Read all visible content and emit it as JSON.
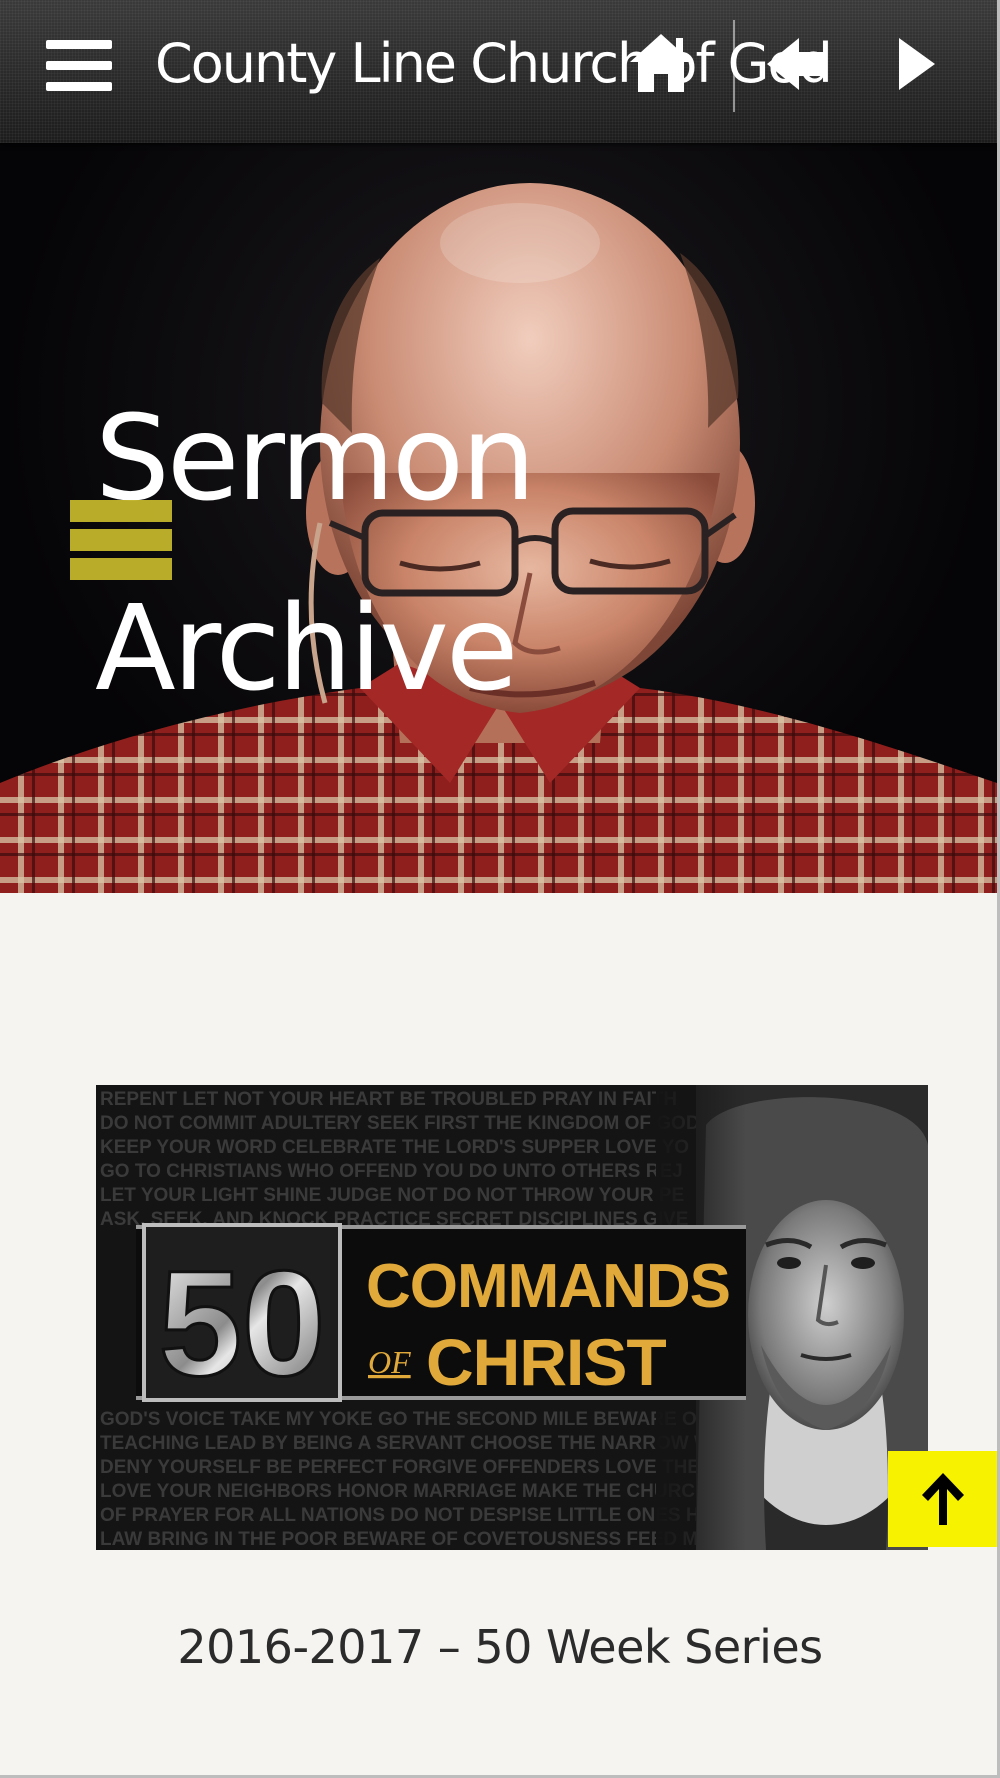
{
  "header": {
    "site_title": "County Line Church of God",
    "icons": [
      "menu-icon",
      "home-icon",
      "back-icon",
      "play-icon"
    ]
  },
  "hero": {
    "title_line1": "Sermon",
    "title_line2": "Archive"
  },
  "series": {
    "banner_number": "50",
    "banner_line1": "COMMANDS",
    "banner_of": "OF",
    "banner_line2": "CHRIST",
    "banner_background_text": [
      "REPENT  LET NOT YOUR HEART BE TROUBLED  PRAY IN FAITH",
      "DO NOT COMMIT ADULTERY  SEEK FIRST THE KINGDOM OF GOD",
      "KEEP YOUR WORD  CELEBRATE THE LORD'S SUPPER  LOVE YO",
      "GO TO CHRISTIANS WHO OFFEND YOU  DO UNTO OTHERS  REJ",
      "LET YOUR LIGHT SHINE  JUDGE NOT  DO NOT THROW YOUR PE",
      "ASK, SEEK, AND KNOCK  PRACTICE SECRET DISCIPLINES GIVE",
      "GOD'S VOICE  TAKE MY YOKE  GO THE SECOND MILE  BEWARE OF",
      "TEACHING  LEAD BY BEING A SERVANT  CHOOSE THE NARROW WA",
      "DENY YOURSELF  BE PERFECT  FORGIVE OFFENDERS  LOVE THE",
      "LOVE YOUR NEIGHBORS  HONOR MARRIAGE  MAKE THE CHURCH",
      "OF PRAYER FOR ALL NATIONS  DO NOT DESPISE LITTLE ONES  HO",
      "LAW  BRING IN THE POOR  BEWARE OF COVETOUSNESS  FEED M"
    ],
    "caption": "2016-2017 – 50 Week Series"
  },
  "scroll_top": {
    "icon": "arrow-up-icon"
  },
  "colors": {
    "accent_yellow": "#f6f200",
    "marker_gold": "#c8bb2c",
    "banner_gold": "#e0a93a"
  }
}
